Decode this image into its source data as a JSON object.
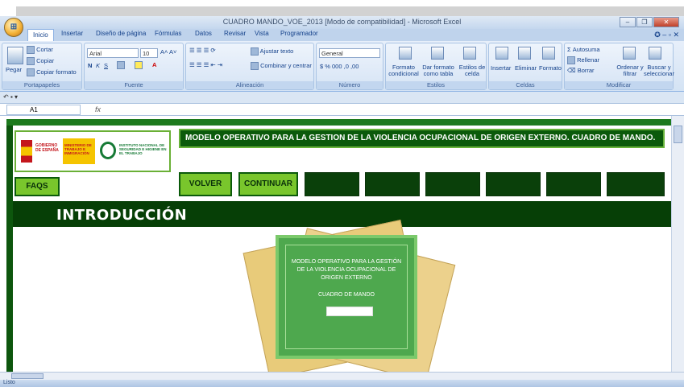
{
  "window": {
    "title": "CUADRO MANDO_VOE_2013 [Modo de compatibilidad] - Microsoft Excel"
  },
  "office_button": {
    "icon": "office-logo-icon"
  },
  "window_controls": {
    "minimize": "–",
    "restore": "❐",
    "close": "✕"
  },
  "ribbon_tabs": [
    "Inicio",
    "Insertar",
    "Diseño de página",
    "Fórmulas",
    "Datos",
    "Revisar",
    "Vista",
    "Programador"
  ],
  "ribbon_right": "✪ – ▫ ✕",
  "clipboard": {
    "paste": "Pegar",
    "cut": "Cortar",
    "copy": "Copiar",
    "format_painter": "Copiar formato",
    "label": "Portapapeles"
  },
  "font": {
    "name": "Arial",
    "size": "10",
    "label": "Fuente"
  },
  "alignment": {
    "wrap": "Ajustar texto",
    "merge": "Combinar y centrar",
    "label": "Alineación"
  },
  "number": {
    "format": "General",
    "label": "Número"
  },
  "styles": {
    "conditional": "Formato condicional",
    "as_table": "Dar formato como tabla",
    "cell_styles": "Estilos de celda",
    "label": "Estilos"
  },
  "cells": {
    "insert": "Insertar",
    "delete": "Eliminar",
    "format": "Formato",
    "label": "Celdas"
  },
  "editing": {
    "autosum": "Autosuma",
    "fill": "Rellenar",
    "clear": "Borrar",
    "sort": "Ordenar y filtrar",
    "find": "Buscar y seleccionar",
    "label": "Modificar"
  },
  "formula_bar": {
    "cell": "A1",
    "fx": "fx",
    "value": ""
  },
  "sheet": {
    "header_text": "MODELO OPERATIVO PARA LA GESTION DE LA VIOLENCIA OCUPACIONAL DE ORIGEN EXTERNO. CUADRO DE MANDO.",
    "logo_gobierno": "GOBIERNO DE ESPAÑA",
    "logo_ministerio": "MINISTERIO DE TRABAJO E INMIGRACIÓN",
    "logo_instituto": "INSTITUTO NACIONAL DE SEGURIDAD E HIGIENE EN EL TRABAJO",
    "faqs": "FAQS",
    "volver": "VOLVER",
    "continuar": "CONTINUAR",
    "intro": "INTRODUCCIÓN",
    "cover_title": "MODELO OPERATIVO PARA LA GESTIÓN DE LA VIOLENCIA OCUPACIONAL DE ORIGEN EXTERNO",
    "cover_sub": "CUADRO DE MANDO"
  },
  "colors": {
    "dark_green": "#0a400a",
    "light_green": "#79c62c",
    "band_green": "#0b5a0b"
  },
  "status": {
    "text": "Listo"
  }
}
